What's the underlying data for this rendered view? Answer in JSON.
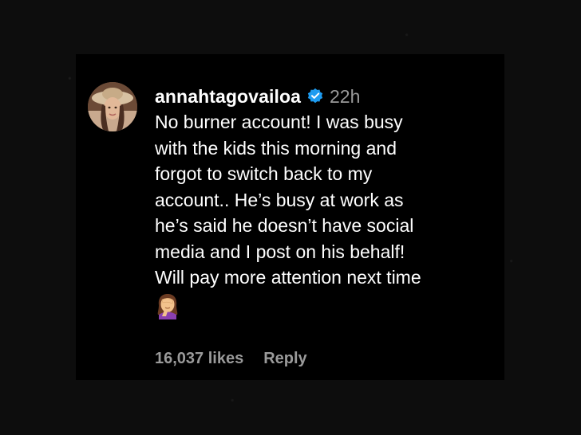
{
  "comment": {
    "username": "annahtagovailoa",
    "timestamp": "22h",
    "verified": true,
    "text_lines": [
      "No burner account! I was busy",
      "with the kids this morning and",
      "forgot to switch back to my",
      "account.. He’s busy at work as",
      "he’s said he doesn’t have social",
      "media and I post on his behalf!",
      "Will pay more attention next time"
    ],
    "emoji": "woman-facepalming-icon",
    "likes_label": "16,037 likes",
    "reply_label": "Reply"
  },
  "colors": {
    "background": "#0b0b0b",
    "card": "#000000",
    "primary_text": "#ffffff",
    "secondary_text": "#9a9a9a",
    "verified_badge": "#1d9bf0"
  }
}
